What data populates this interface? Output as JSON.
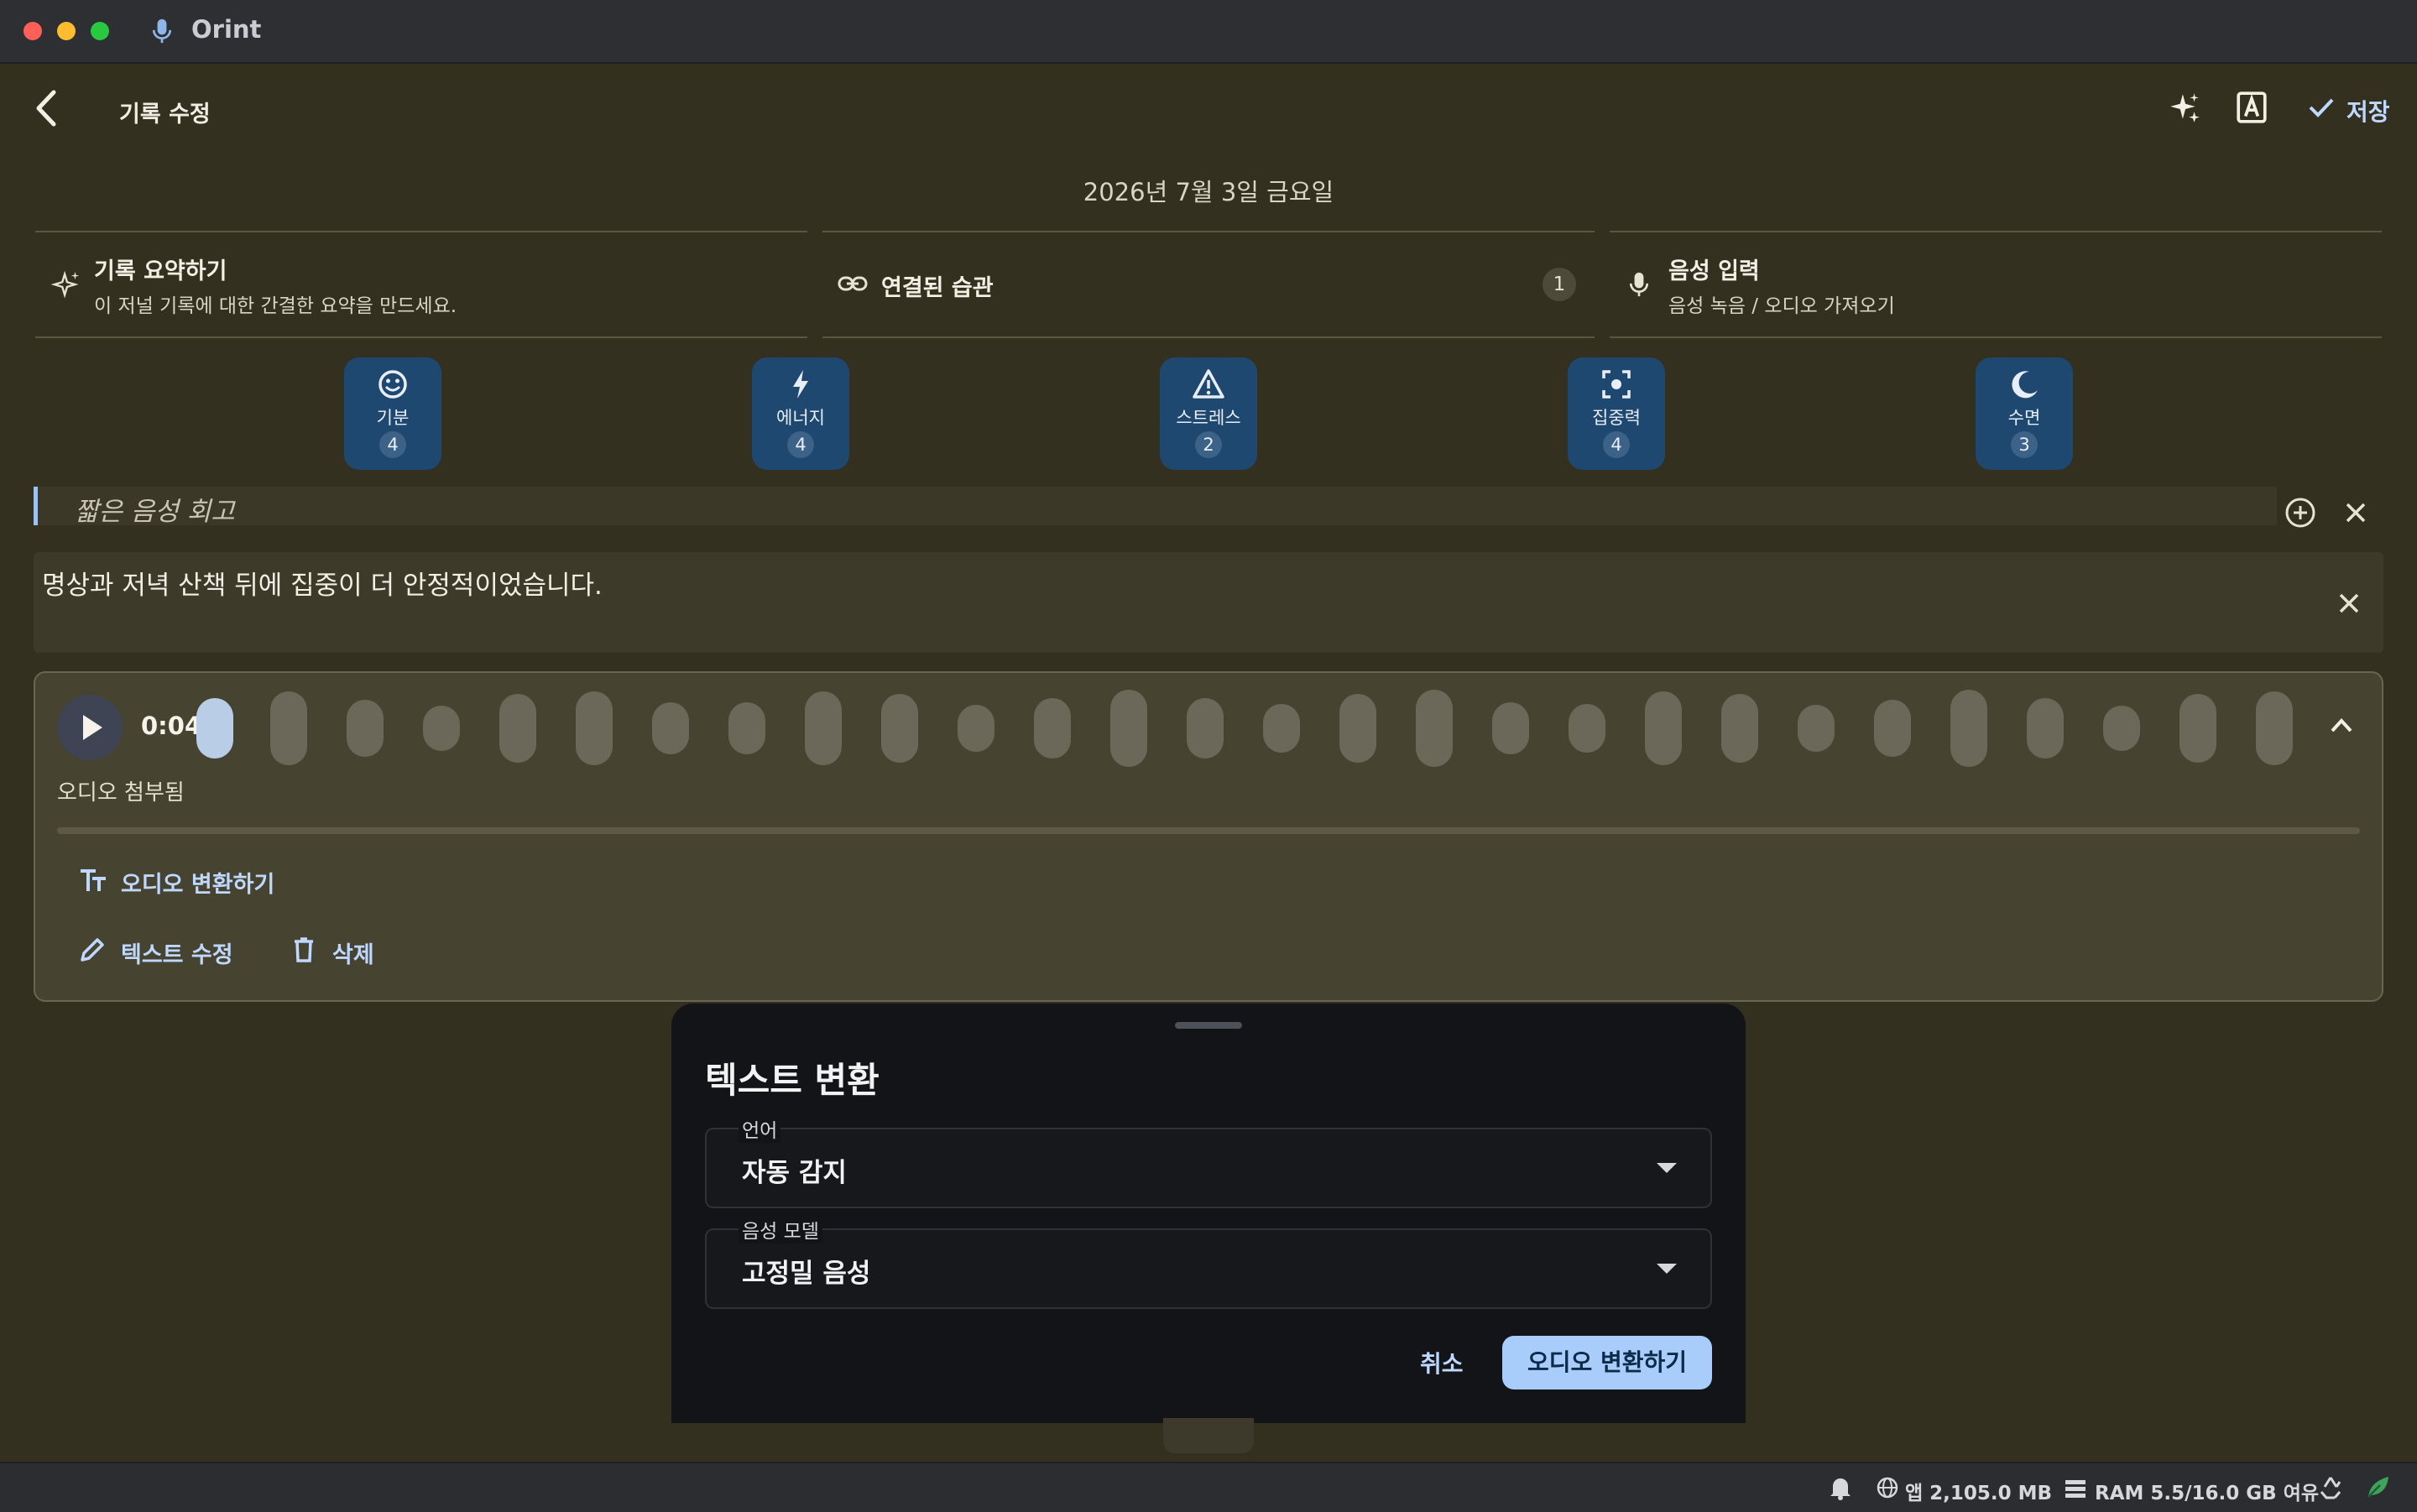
{
  "window": {
    "app_title": "Orint"
  },
  "topbar": {
    "title": "기록 수정",
    "save_label": "저장"
  },
  "date": "2026년 7월 3일 금요일",
  "cards": {
    "summary": {
      "title": "기록 요약하기",
      "subtitle": "이 저널 기록에 대한 간결한 요약을 만드세요."
    },
    "habits": {
      "title": "연결된 습관",
      "count": "1"
    },
    "voice": {
      "title": "음성 입력",
      "subtitle": "음성 녹음 / 오디오 가져오기"
    }
  },
  "moods": [
    {
      "label": "기분",
      "value": "4",
      "icon": "smile-icon"
    },
    {
      "label": "에너지",
      "value": "4",
      "icon": "bolt-icon"
    },
    {
      "label": "스트레스",
      "value": "2",
      "icon": "warning-icon"
    },
    {
      "label": "집중력",
      "value": "4",
      "icon": "focus-icon"
    },
    {
      "label": "수면",
      "value": "3",
      "icon": "moon-icon"
    }
  ],
  "entry": {
    "title_placeholder": "짧은 음성 회고",
    "body": "명상과 저녁 산책 뒤에 집중이 더 안정적이었습니다."
  },
  "audio": {
    "time": "0:04",
    "status": "오디오 첨부됨",
    "transcribe_label": "오디오 변환하기",
    "edit_label": "텍스트 수정",
    "delete_label": "삭제"
  },
  "sheet": {
    "title": "텍스트 변환",
    "language": {
      "label": "언어",
      "value": "자동 감지"
    },
    "model": {
      "label": "음성 모델",
      "value": "고정밀 음성"
    },
    "cancel_label": "취소",
    "confirm_label": "오디오 변환하기"
  },
  "statusbar": {
    "app_memory": "앱 2,105.0 MB",
    "ram": "RAM 5.5/16.0 GB 여유"
  },
  "colors": {
    "accent": "#a9cdfb",
    "mood_tile": "#1f4870",
    "background": "#34301f"
  }
}
